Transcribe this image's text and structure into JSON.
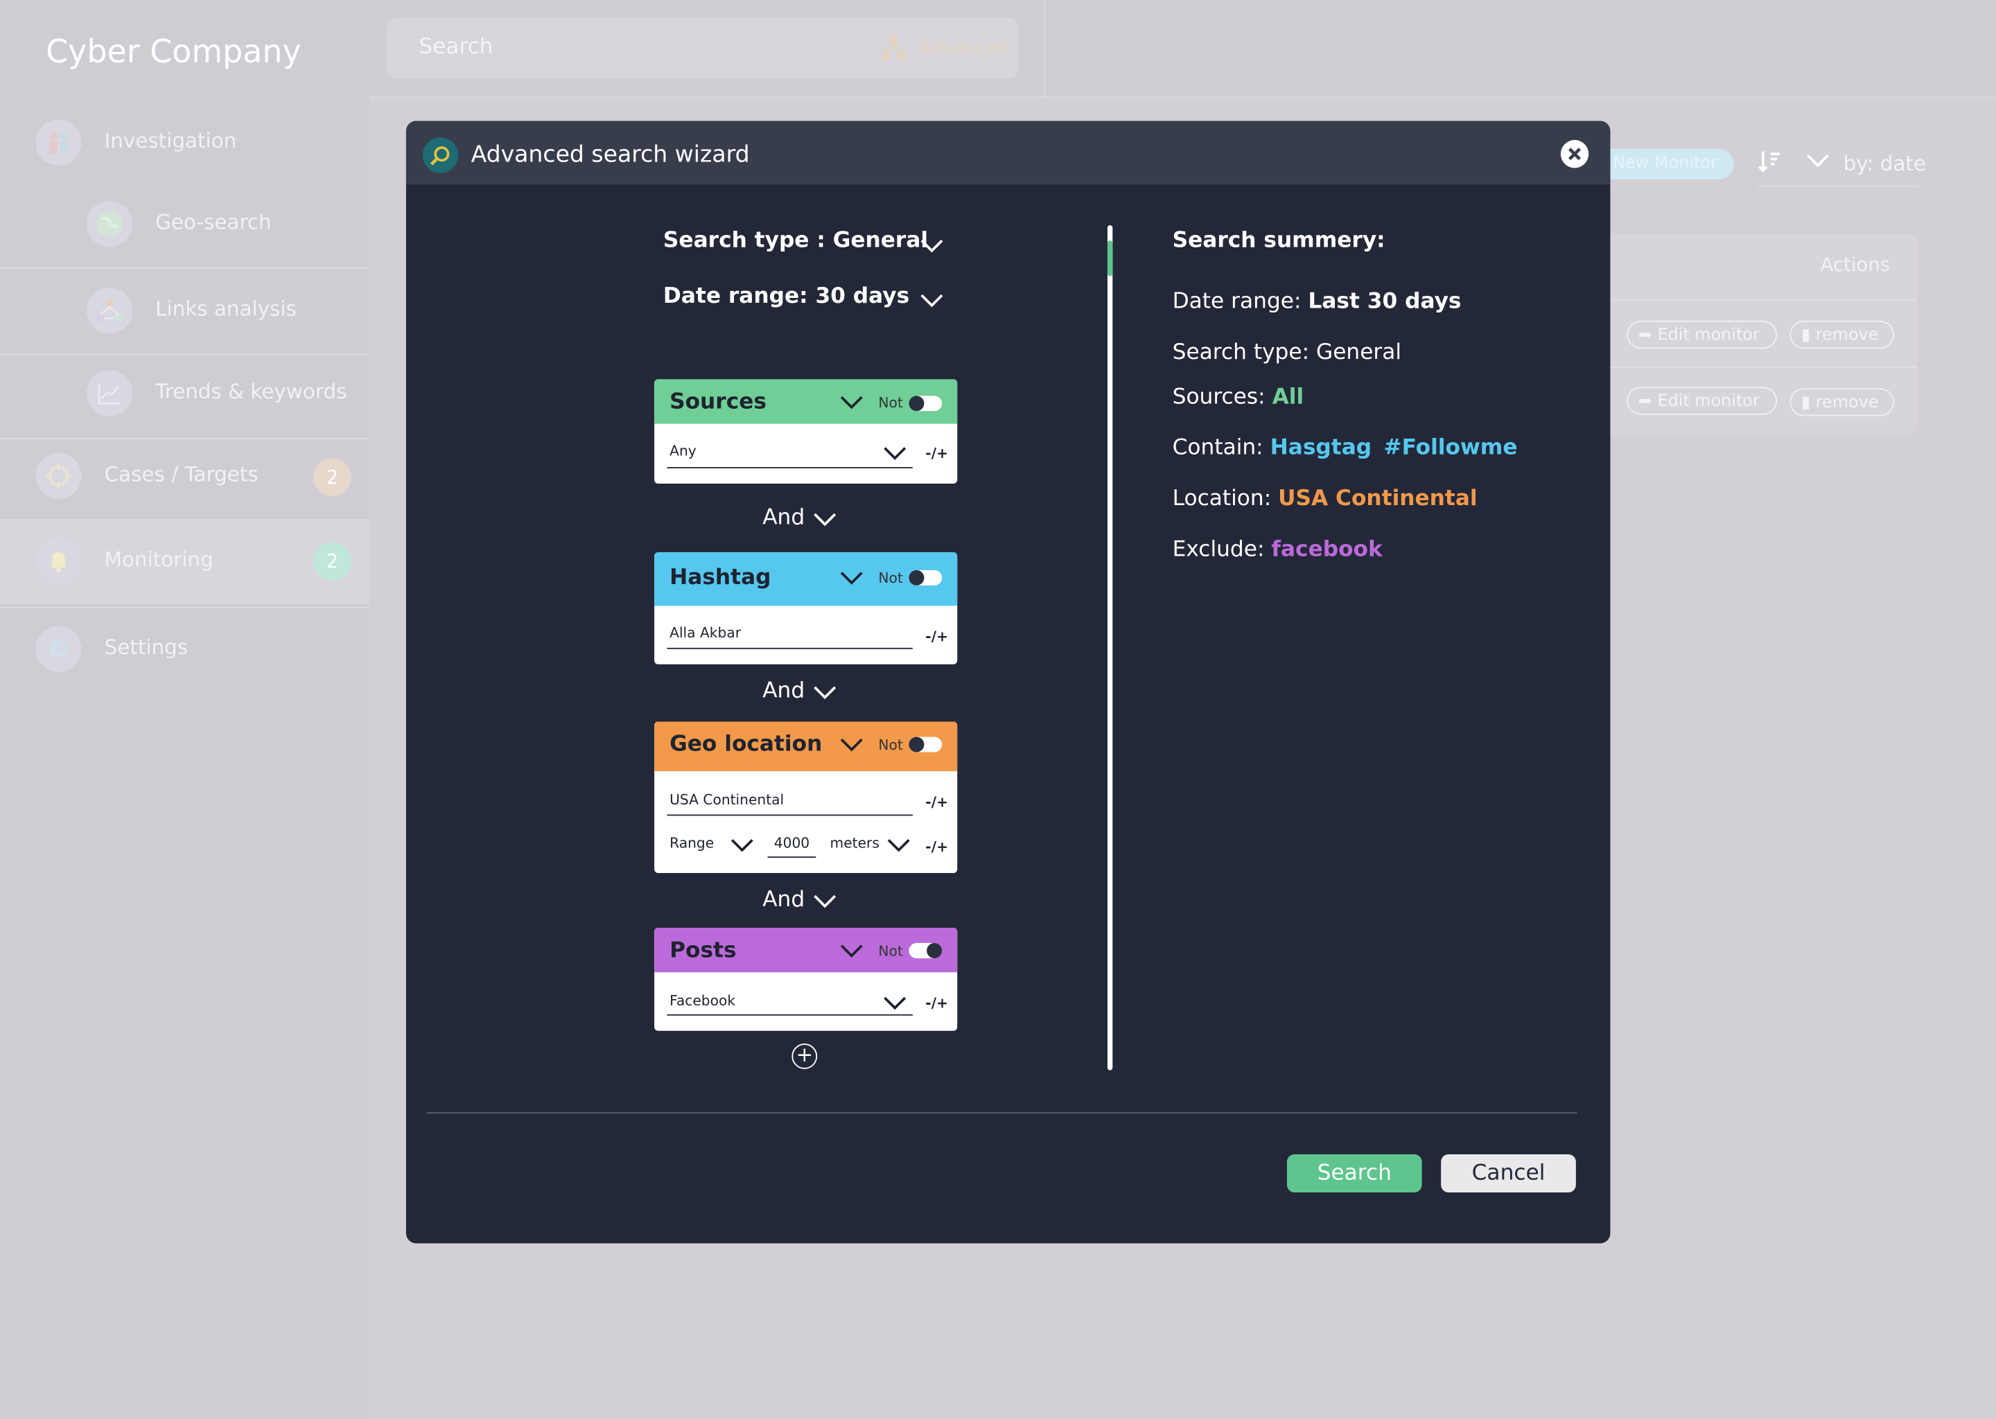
{
  "brand": "Cyber Company",
  "sidebar": {
    "items": [
      {
        "label": "Investigation"
      },
      {
        "label": "Geo-search"
      },
      {
        "label": "Links analysis"
      },
      {
        "label": "Trends & keywords"
      },
      {
        "label": "Cases / Targets",
        "badge": "2"
      },
      {
        "label": "Monitoring",
        "badge": "2"
      },
      {
        "label": "Settings"
      }
    ]
  },
  "topbar": {
    "search_placeholder": "Search",
    "advanced_label": "Advanced"
  },
  "background": {
    "new_monitor": "New Monitor",
    "sort_label": "by: date",
    "actions_header": "Actions",
    "edit_label": "Edit monitor",
    "remove_label": "remove"
  },
  "modal": {
    "title": "Advanced search wizard",
    "search_type": "Search type : General",
    "date_range": "Date range: 30 days",
    "and_label": "And",
    "not_label": "Not",
    "pm_label": "-/+",
    "cards": {
      "sources": {
        "title": "Sources",
        "value": "Any",
        "color": "#6fcf97",
        "not": false
      },
      "hashtag": {
        "title": "Hashtag",
        "value": "Alla Akbar",
        "color": "#56c8f0",
        "not": false
      },
      "geo": {
        "title": "Geo location",
        "value": "USA Continental",
        "range_label": "Range",
        "range_value": "4000",
        "unit": "meters",
        "color": "#f2994a",
        "not": false
      },
      "posts": {
        "title": "Posts",
        "value": "Facebook",
        "color": "#bb6bd9",
        "not": true
      }
    },
    "summary": {
      "title": "Search summery:",
      "date_label": "Date range:",
      "date_value": "Last 30 days",
      "type_label": "Search  type: General",
      "sources_label": "Sources:",
      "sources_value": "All",
      "contain_label": "Contain:",
      "contain_value1": "Hasgtag",
      "contain_value2": "#Followme",
      "location_label": "Location:",
      "location_value": "USA Continental",
      "exclude_label": "Exclude:",
      "exclude_value": "facebook"
    },
    "search_button": "Search",
    "cancel_button": "Cancel"
  },
  "colors": {
    "modal_bg": "#232838",
    "header_bg": "#383d4c",
    "accent_green": "#5ec58e",
    "sources_green": "#6fcf97",
    "hashtag_blue": "#56c8f0",
    "geo_orange": "#f2994a",
    "posts_purple": "#bb6bd9"
  }
}
